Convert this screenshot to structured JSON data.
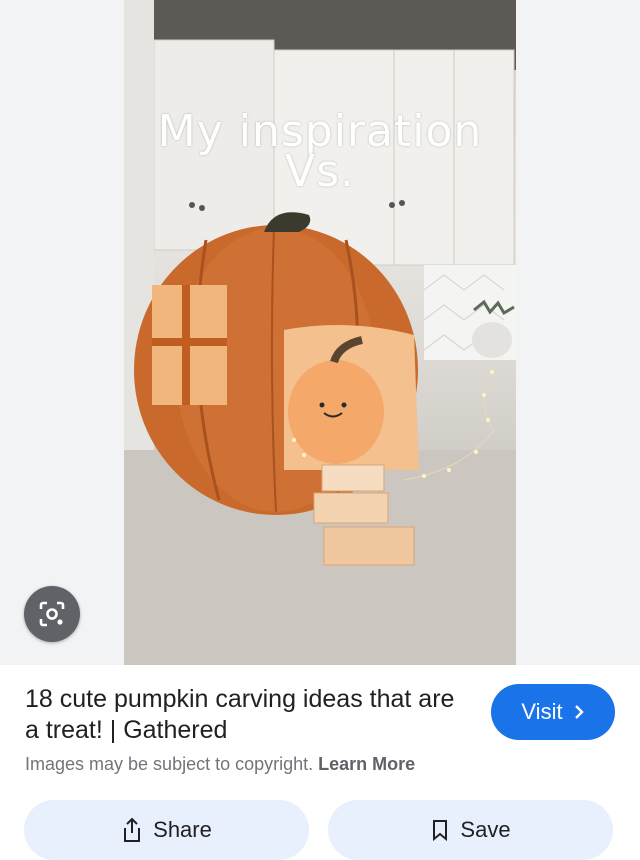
{
  "image": {
    "overlay_line1": "My inspiration",
    "overlay_line2": "Vs."
  },
  "lens": {
    "icon": "lens-search-icon"
  },
  "result": {
    "title": "18 cute pumpkin carving ideas that are a treat! | Gathered",
    "visit_label": "Visit",
    "copyright_text": "Images may be subject to copyright.",
    "learn_more_label": "Learn More"
  },
  "actions": {
    "share_label": "Share",
    "save_label": "Save"
  },
  "colors": {
    "accent": "#1a73e8",
    "action_bg": "#e8f0fe",
    "lens_bg": "#5f6368"
  }
}
